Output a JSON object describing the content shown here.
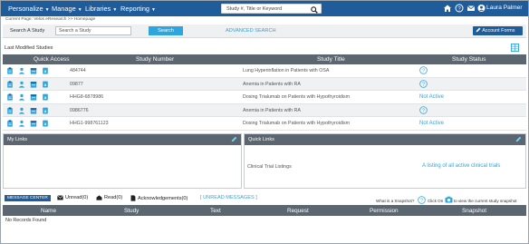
{
  "nav": {
    "menus": [
      "Personalize",
      "Manage",
      "Libraries",
      "Reporting"
    ],
    "search_placeholder": "Study #, Title or Keyword",
    "user": "Laura Palmer",
    "icons": [
      "home-icon",
      "help-icon",
      "mail-icon",
      "user-icon"
    ]
  },
  "breadcrumb": "Current Page: Velos eResearch >> Homepage",
  "study_search": {
    "label": "Search A Study",
    "placeholder": "Search a Study",
    "button": "Search",
    "advanced": "ADVANCED SEARCH",
    "account_forms": "Account Forms"
  },
  "studies": {
    "section_label": "Last Modified Studies",
    "columns": [
      "Quick Access",
      "Study Number",
      "Study Title",
      "Study Status"
    ],
    "rows": [
      {
        "number": "484744",
        "title": "Lung Hyperinflation in Patients with OSA",
        "status": "?"
      },
      {
        "number": "09877",
        "title": "Anemia in Patients with RA",
        "status": "?"
      },
      {
        "number": "HHG8-6878986",
        "title": "Dosing Trialumab on Patients with Hypothyroidism",
        "status": "Not Active"
      },
      {
        "number": "0986776",
        "title": "Anemia in Patients with RA",
        "status": "?"
      },
      {
        "number": "HHG1-998761123",
        "title": "Dosing Trialumab on Patients with Hypothyroidism",
        "status": "Not Active"
      }
    ]
  },
  "panels": {
    "my_links": "My Links",
    "quick_links": "Quick Links",
    "quick_link_name": "Clinical Trial Listings",
    "quick_link_desc": "A listing of all active clinical trials"
  },
  "messages": {
    "center": "MESSAGE CENTER",
    "unread": "Unread(0)",
    "read": "Read(0)",
    "acknowledgements": "Acknowledgements(0)",
    "unread_messages": "[ UNREAD MESSAGES ]",
    "snapshot_question": "What is a Snapshot?",
    "snapshot_hint_pre": "Click On",
    "snapshot_hint_post": "to view the current study snapshot",
    "columns": [
      "Name",
      "Study",
      "Text",
      "Request",
      "Permission",
      "Snapshot"
    ],
    "empty": "No Records Found"
  },
  "colors": {
    "nav_bg": "#1f5c99",
    "header_bg": "#5b6670",
    "accent": "#2ea6dd"
  }
}
